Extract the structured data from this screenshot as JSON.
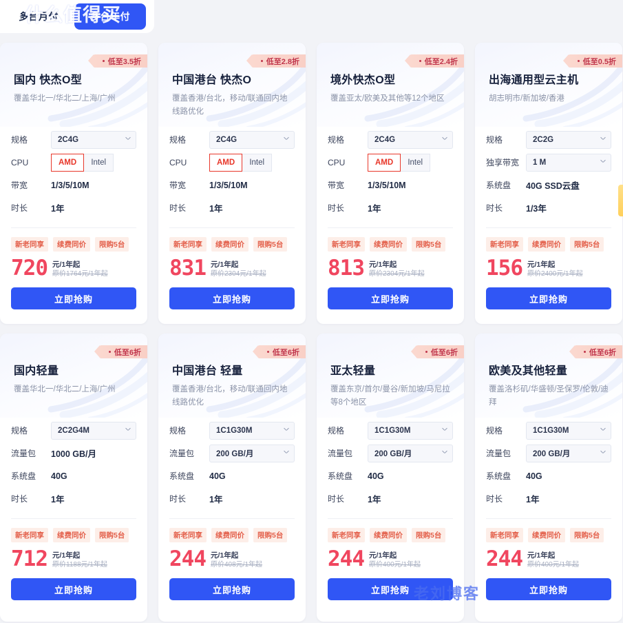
{
  "tabs": [
    {
      "label": "多台月付",
      "active": false
    },
    {
      "label": "多台年付",
      "active": true
    }
  ],
  "labels": {
    "spec": "规格",
    "cpu": "CPU",
    "bandwidth": "带宽",
    "duration": "时长",
    "dedicated_bandwidth": "独享带宽",
    "system_disk": "系统盘",
    "traffic_package": "流量包",
    "buy": "立即抢购",
    "unit": "元/1年起"
  },
  "cpu_options": [
    "AMD",
    "Intel"
  ],
  "tags": [
    "新老同享",
    "续费同价",
    "限购5台"
  ],
  "watermarks": {
    "blog": "老刘博客",
    "smzdm_logo": "值",
    "smzdm": "什么值得买"
  },
  "cards": [
    {
      "title": "国内 快杰O型",
      "badge": "低至3.5折",
      "subtitle": "覆盖华北一/华北二/上海/广州",
      "rows": [
        {
          "label": "规格",
          "type": "select",
          "value": "2C4G"
        },
        {
          "label": "CPU",
          "type": "toggle",
          "value": "AMD",
          "options": [
            "AMD",
            "Intel"
          ]
        },
        {
          "label": "带宽",
          "type": "text",
          "value": "1/3/5/10M"
        },
        {
          "label": "时长",
          "type": "text",
          "value": "1年"
        }
      ],
      "price": "720",
      "unit": "元/1年起",
      "original": "原价1764元/1年起",
      "button": "立即抢购"
    },
    {
      "title": "中国港台 快杰O",
      "badge": "低至2.8折",
      "subtitle": "覆盖香港/台北，移动/联通回内地线路优化",
      "rows": [
        {
          "label": "规格",
          "type": "select",
          "value": "2C4G"
        },
        {
          "label": "CPU",
          "type": "toggle",
          "value": "AMD",
          "options": [
            "AMD",
            "Intel"
          ]
        },
        {
          "label": "带宽",
          "type": "text",
          "value": "1/3/5/10M"
        },
        {
          "label": "时长",
          "type": "text",
          "value": "1年"
        }
      ],
      "price": "831",
      "unit": "元/1年起",
      "original": "原价2304元/1年起",
      "button": "立即抢购"
    },
    {
      "title": "境外快杰O型",
      "badge": "低至2.4折",
      "subtitle": "覆盖亚太/欧美及其他等12个地区",
      "rows": [
        {
          "label": "规格",
          "type": "select",
          "value": "2C4G"
        },
        {
          "label": "CPU",
          "type": "toggle",
          "value": "AMD",
          "options": [
            "AMD",
            "Intel"
          ]
        },
        {
          "label": "带宽",
          "type": "text",
          "value": "1/3/5/10M"
        },
        {
          "label": "时长",
          "type": "text",
          "value": "1年"
        }
      ],
      "price": "813",
      "unit": "元/1年起",
      "original": "原价2304元/1年起",
      "button": "立即抢购"
    },
    {
      "title": "出海通用型云主机",
      "badge": "低至0.5折",
      "subtitle": "胡志明市/新加坡/香港",
      "rows": [
        {
          "label": "规格",
          "type": "select",
          "value": "2C2G"
        },
        {
          "label": "独享带宽",
          "type": "select",
          "value": "1 M"
        },
        {
          "label": "系统盘",
          "type": "text",
          "value": "40G SSD云盘"
        },
        {
          "label": "时长",
          "type": "text",
          "value": "1/3年"
        }
      ],
      "price": "156",
      "unit": "元/1年起",
      "original": "原价2400元/1年起",
      "button": "立即抢购"
    },
    {
      "title": "国内轻量",
      "badge": "低至6折",
      "subtitle": "覆盖华北一/华北二/上海/广州",
      "rows": [
        {
          "label": "规格",
          "type": "select",
          "value": "2C2G4M"
        },
        {
          "label": "流量包",
          "type": "text",
          "value": "1000 GB/月"
        },
        {
          "label": "系统盘",
          "type": "text",
          "value": "40G"
        },
        {
          "label": "时长",
          "type": "text",
          "value": "1年"
        }
      ],
      "price": "712",
      "unit": "元/1年起",
      "original": "原价1188元/1年起",
      "button": "立即抢购"
    },
    {
      "title": "中国港台 轻量",
      "badge": "低至6折",
      "subtitle": "覆盖香港/台北，移动/联通回内地线路优化",
      "rows": [
        {
          "label": "规格",
          "type": "select",
          "value": "1C1G30M"
        },
        {
          "label": "流量包",
          "type": "select",
          "value": "200 GB/月"
        },
        {
          "label": "系统盘",
          "type": "text",
          "value": "40G"
        },
        {
          "label": "时长",
          "type": "text",
          "value": "1年"
        }
      ],
      "price": "244",
      "unit": "元/1年起",
      "original": "原价408元/1年起",
      "button": "立即抢购"
    },
    {
      "title": "亚太轻量",
      "badge": "低至6折",
      "subtitle": "覆盖东京/首尔/曼谷/新加坡/马尼拉等8个地区",
      "rows": [
        {
          "label": "规格",
          "type": "select",
          "value": "1C1G30M"
        },
        {
          "label": "流量包",
          "type": "select",
          "value": "200 GB/月"
        },
        {
          "label": "系统盘",
          "type": "text",
          "value": "40G"
        },
        {
          "label": "时长",
          "type": "text",
          "value": "1年"
        }
      ],
      "price": "244",
      "unit": "元/1年起",
      "original": "原价400元/1年起",
      "button": "立即抢购"
    },
    {
      "title": "欧美及其他轻量",
      "badge": "低至6折",
      "subtitle": "覆盖洛杉矶/华盛顿/圣保罗/伦敦/迪拜",
      "rows": [
        {
          "label": "规格",
          "type": "select",
          "value": "1C1G30M"
        },
        {
          "label": "流量包",
          "type": "select",
          "value": "200 GB/月"
        },
        {
          "label": "系统盘",
          "type": "text",
          "value": "40G"
        },
        {
          "label": "时长",
          "type": "text",
          "value": "1年"
        }
      ],
      "price": "244",
      "unit": "元/1年起",
      "original": "原价400元/1年起",
      "button": "立即抢购"
    }
  ]
}
